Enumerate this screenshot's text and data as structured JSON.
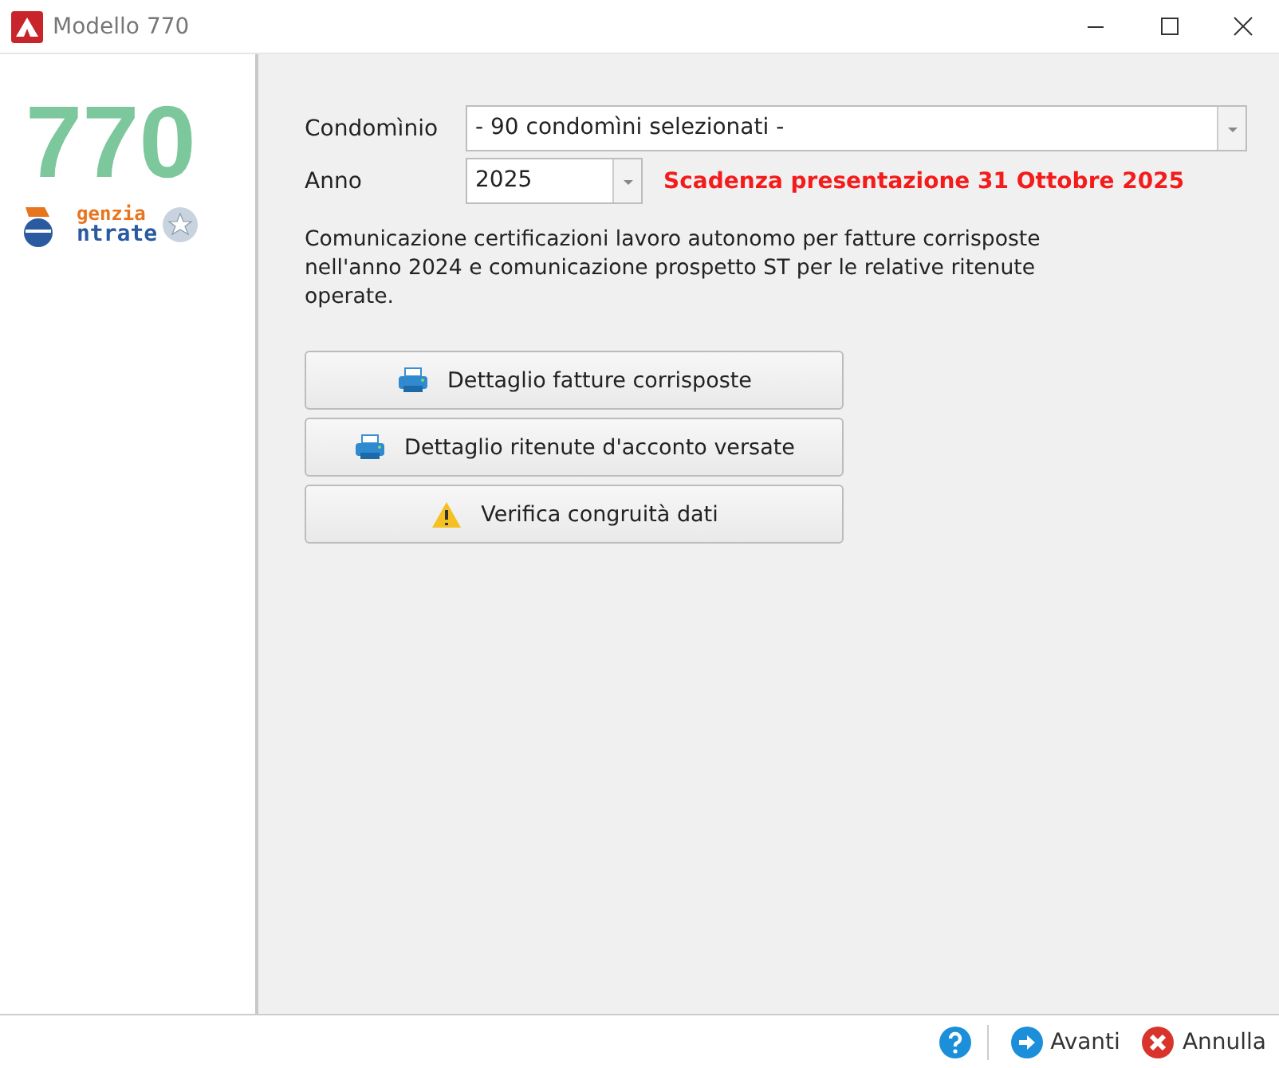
{
  "window": {
    "title": "Modello 770"
  },
  "logo": {
    "number": "770",
    "line1": "genzia",
    "line2": "ntrate"
  },
  "form": {
    "condominio": {
      "label": "Condomìnio",
      "value": "- 90 condomìni selezionati -"
    },
    "anno": {
      "label": "Anno",
      "value": "2025"
    },
    "deadline": "Scadenza presentazione 31 Ottobre 2025",
    "description": "Comunicazione certificazioni lavoro autonomo per fatture corrisposte nell'anno 2024 e comunicazione prospetto ST per le relative ritenute operate."
  },
  "actions": [
    {
      "label": "Dettaglio fatture corrisposte",
      "kind": "printer"
    },
    {
      "label": "Dettaglio ritenute d'acconto versate",
      "kind": "printer"
    },
    {
      "label": "Verifica congruità dati",
      "kind": "warning"
    }
  ],
  "footer": [
    {
      "kind": "help"
    },
    {
      "kind": "next",
      "label": "Avanti"
    },
    {
      "kind": "cancel",
      "label": "Annulla"
    }
  ]
}
